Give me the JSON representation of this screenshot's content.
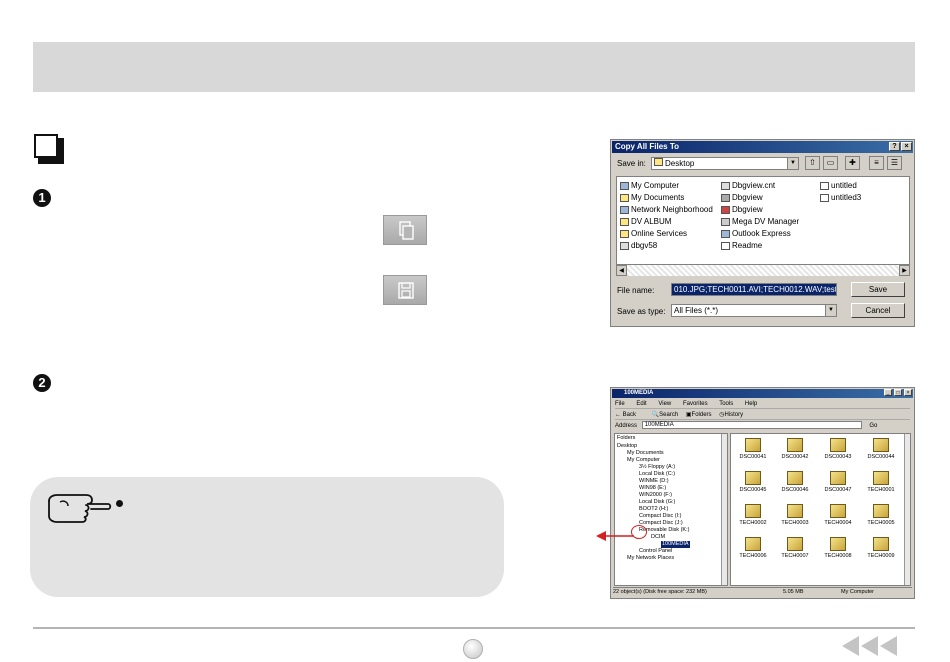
{
  "copy_dialog": {
    "title": "Copy All Files To",
    "help_btn": "?",
    "close_btn": "×",
    "save_in_label": "Save in:",
    "save_in_value": "Desktop",
    "items_col1": [
      "My Computer",
      "My Documents",
      "Network Neighborhood",
      "DV ALBUM",
      "Online Services",
      "dbgv58"
    ],
    "items_col2": [
      "Dbgview.cnt",
      "Dbgview",
      "Dbgview",
      "Mega DV Manager",
      "Outlook Express",
      "Readme"
    ],
    "items_col3": [
      "untitled",
      "untitled3"
    ],
    "file_name_label": "File name:",
    "file_name_value": "010.JPG;TECH0011.AVI;TECH0012.WAV;test!",
    "save_type_label": "Save as type:",
    "save_type_value": "All Files (*.*)",
    "save_button": "Save",
    "cancel_button": "Cancel"
  },
  "explorer": {
    "title": "100MEDIA",
    "menu": [
      "File",
      "Edit",
      "View",
      "Favorites",
      "Tools",
      "Help"
    ],
    "toolbar": [
      "Back",
      "Search",
      "Folders",
      "History"
    ],
    "address_label": "Address",
    "address_value": "100MEDIA",
    "go_label": "Go",
    "folders_header": "Folders",
    "tree": [
      "Desktop",
      "My Documents",
      "My Computer",
      "3½ Floppy (A:)",
      "Local Disk (C:)",
      "WINME (D:)",
      "WIN98 (E:)",
      "WIN2000 (F:)",
      "Local Disk (G:)",
      "BOOT2 (H:)",
      "Compact Disc (I:)",
      "Compact Disc (J:)",
      "Removable Disk (K:)",
      "DCIM",
      "100MEDIA",
      "Control Panel",
      "My Network Places"
    ],
    "files": [
      "DSC00041",
      "DSC00042",
      "DSC00043",
      "DSC00044",
      "DSC00045",
      "DSC00046",
      "DSC00047",
      "TECH0001",
      "TECH0002",
      "TECH0003",
      "TECH0004",
      "TECH0005",
      "TECH0006",
      "TECH0007",
      "TECH0008",
      "TECH0009"
    ],
    "status_left": "22 object(s) (Disk free space: 232 MB)",
    "status_size": "5.05 MB",
    "status_right": "My Computer"
  },
  "colors": {
    "accent": "#0a246a",
    "arrow": "#d42020"
  }
}
